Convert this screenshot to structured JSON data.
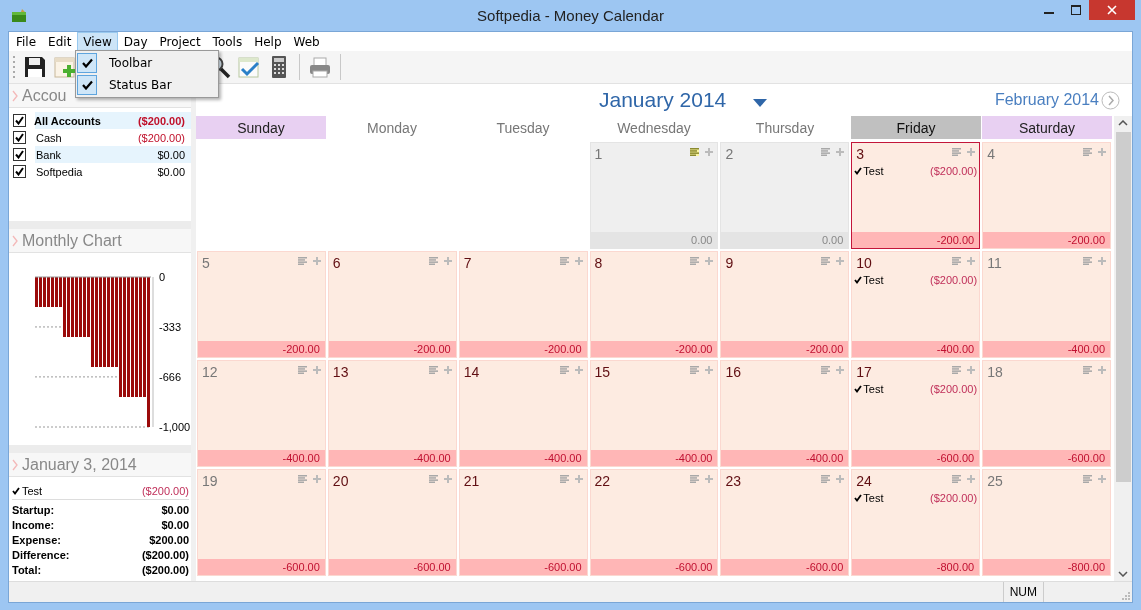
{
  "window": {
    "title": "Softpedia - Money Calendar"
  },
  "menu": [
    {
      "label": "File",
      "selected": false
    },
    {
      "label": "Edit",
      "selected": false
    },
    {
      "label": "View",
      "selected": true
    },
    {
      "label": "Day",
      "selected": false
    },
    {
      "label": "Project",
      "selected": false
    },
    {
      "label": "Tools",
      "selected": false
    },
    {
      "label": "Help",
      "selected": false
    },
    {
      "label": "Web",
      "selected": false
    }
  ],
  "view_menu": [
    {
      "label": "Toolbar",
      "checked": true
    },
    {
      "label": "Status Bar",
      "checked": true
    }
  ],
  "accounts_panel": {
    "title": "Accou",
    "accounts": [
      {
        "name": "All Accounts",
        "amount": "($200.00)",
        "checked": true,
        "kind": "total",
        "negative": true,
        "highlighted": true
      },
      {
        "name": "Cash",
        "amount": "($200.00)",
        "checked": true,
        "kind": "account",
        "negative": true,
        "highlighted": false
      },
      {
        "name": "Bank",
        "amount": "$0.00",
        "checked": true,
        "kind": "account",
        "negative": false,
        "highlighted": true
      },
      {
        "name": "Softpedia",
        "amount": "$0.00",
        "checked": true,
        "kind": "account",
        "negative": false,
        "highlighted": false
      }
    ]
  },
  "chart_panel": {
    "title": "Monthly Chart",
    "chart_data": {
      "type": "bar",
      "series": [
        {
          "color": "#9b0a0a",
          "values": [
            -200,
            -200,
            -200,
            -200,
            -200,
            -200,
            -200,
            -400,
            -400,
            -400,
            -400,
            -400,
            -400,
            -400,
            -600,
            -600,
            -600,
            -600,
            -600,
            -600,
            -600,
            -800,
            -800,
            -800,
            -800,
            -800,
            -800,
            -800,
            -1000
          ]
        }
      ],
      "ylim": [
        -1000,
        0
      ],
      "yticks": [
        {
          "value": 0,
          "label": "0"
        },
        {
          "value": -333,
          "label": "-333"
        },
        {
          "value": -666,
          "label": "-666"
        },
        {
          "value": -1000,
          "label": "-1,000"
        }
      ]
    }
  },
  "day_panel": {
    "title": "January 3, 2014",
    "entries": [
      {
        "label": "Test",
        "amount": "($200.00)",
        "checked": true
      }
    ],
    "summary": [
      {
        "label": "Startup:",
        "value": "$0.00"
      },
      {
        "label": "Income:",
        "value": "$0.00"
      },
      {
        "label": "Expense:",
        "value": "$200.00"
      },
      {
        "label": "Difference:",
        "value": "($200.00)"
      },
      {
        "label": "Total:",
        "value": "($200.00)"
      }
    ]
  },
  "calendar": {
    "month": "January 2014",
    "next_month": "February 2014",
    "weekdays": [
      {
        "label": "Sunday",
        "selected": false,
        "kind": "weekend"
      },
      {
        "label": "Monday",
        "selected": false,
        "kind": "weekday"
      },
      {
        "label": "Tuesday",
        "selected": false,
        "kind": "weekday"
      },
      {
        "label": "Wednesday",
        "selected": false,
        "kind": "weekday"
      },
      {
        "label": "Thursday",
        "selected": false,
        "kind": "weekday"
      },
      {
        "label": "Friday",
        "selected": true,
        "kind": "weekday"
      },
      {
        "label": "Saturday",
        "selected": false,
        "kind": "weekend"
      }
    ],
    "weeks": [
      [
        {
          "kind": "blank"
        },
        {
          "kind": "blank"
        },
        {
          "kind": "blank"
        },
        {
          "kind": "past",
          "day": "1",
          "total": "0.00",
          "selected": false,
          "note": true
        },
        {
          "kind": "past",
          "day": "2",
          "total": "0.00",
          "selected": false,
          "note": false
        },
        {
          "kind": "day",
          "day": "3",
          "total": "-200.00",
          "selected": true,
          "note": false,
          "entries": [
            {
              "label": "Test",
              "amount": "($200.00)",
              "checked": true
            }
          ]
        },
        {
          "kind": "day",
          "day": "4",
          "total": "-200.00",
          "selected": false,
          "note": false
        }
      ],
      [
        {
          "kind": "day",
          "day": "5",
          "total": "-200.00",
          "selected": false,
          "note": false
        },
        {
          "kind": "day",
          "day": "6",
          "total": "-200.00",
          "selected": false,
          "note": false
        },
        {
          "kind": "day",
          "day": "7",
          "total": "-200.00",
          "selected": false,
          "note": false
        },
        {
          "kind": "day",
          "day": "8",
          "total": "-200.00",
          "selected": false,
          "note": false
        },
        {
          "kind": "day",
          "day": "9",
          "total": "-200.00",
          "selected": false,
          "note": false
        },
        {
          "kind": "day",
          "day": "10",
          "total": "-400.00",
          "selected": false,
          "note": false,
          "entries": [
            {
              "label": "Test",
              "amount": "($200.00)",
              "checked": true
            }
          ]
        },
        {
          "kind": "day",
          "day": "11",
          "total": "-400.00",
          "selected": false,
          "note": false
        }
      ],
      [
        {
          "kind": "day",
          "day": "12",
          "total": "-400.00",
          "selected": false,
          "note": false
        },
        {
          "kind": "day",
          "day": "13",
          "total": "-400.00",
          "selected": false,
          "note": false
        },
        {
          "kind": "day",
          "day": "14",
          "total": "-400.00",
          "selected": false,
          "note": false
        },
        {
          "kind": "day",
          "day": "15",
          "total": "-400.00",
          "selected": false,
          "note": false
        },
        {
          "kind": "day",
          "day": "16",
          "total": "-400.00",
          "selected": false,
          "note": false
        },
        {
          "kind": "day",
          "day": "17",
          "total": "-600.00",
          "selected": false,
          "note": false,
          "entries": [
            {
              "label": "Test",
              "amount": "($200.00)",
              "checked": true
            }
          ]
        },
        {
          "kind": "day",
          "day": "18",
          "total": "-600.00",
          "selected": false,
          "note": false
        }
      ],
      [
        {
          "kind": "day",
          "day": "19",
          "total": "-600.00",
          "selected": false,
          "note": false
        },
        {
          "kind": "day",
          "day": "20",
          "total": "-600.00",
          "selected": false,
          "note": false
        },
        {
          "kind": "day",
          "day": "21",
          "total": "-600.00",
          "selected": false,
          "note": false
        },
        {
          "kind": "day",
          "day": "22",
          "total": "-600.00",
          "selected": false,
          "note": false
        },
        {
          "kind": "day",
          "day": "23",
          "total": "-600.00",
          "selected": false,
          "note": false
        },
        {
          "kind": "day",
          "day": "24",
          "total": "-800.00",
          "selected": false,
          "note": false,
          "entries": [
            {
              "label": "Test",
              "amount": "($200.00)",
              "checked": true
            }
          ]
        },
        {
          "kind": "day",
          "day": "25",
          "total": "-800.00",
          "selected": false,
          "note": false
        }
      ]
    ]
  },
  "status_bar": {
    "indicator": "NUM"
  }
}
